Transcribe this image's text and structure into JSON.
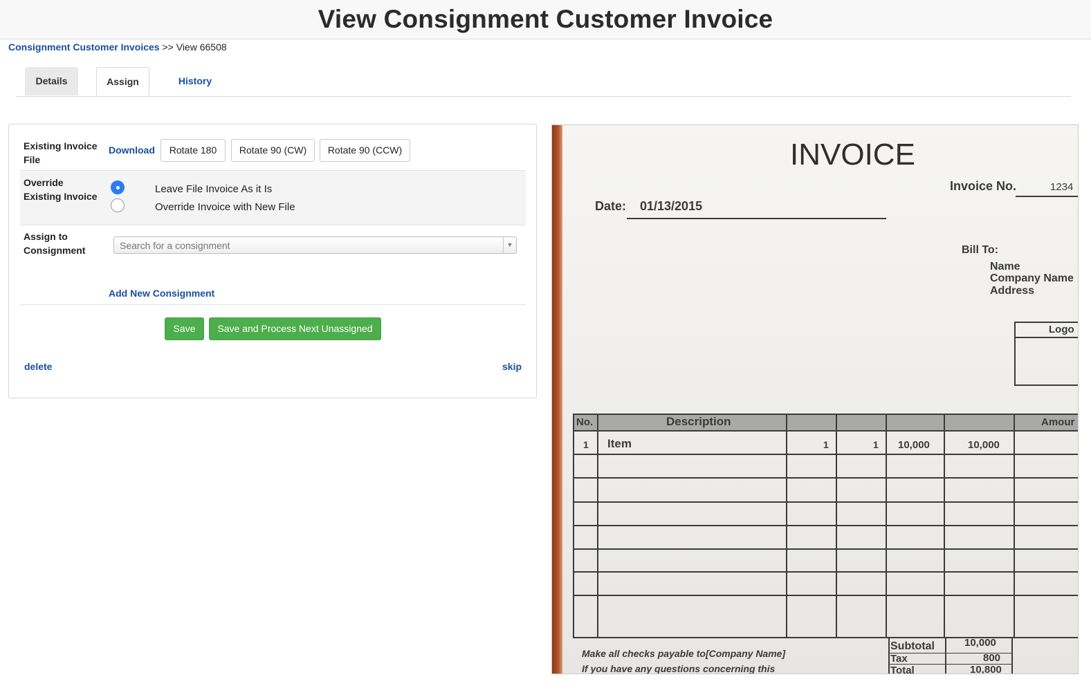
{
  "page": {
    "title": "View Consignment Customer Invoice"
  },
  "breadcrumb": {
    "link": "Consignment Customer Invoices",
    "separator": " >> ",
    "current": "View 66508"
  },
  "tabs": [
    {
      "label": "Details"
    },
    {
      "label": "Assign"
    },
    {
      "label": "History"
    }
  ],
  "existing_file": {
    "label_line1": "Existing Invoice",
    "label_line2": "File",
    "download": "Download",
    "rotate180": "Rotate 180",
    "rotate90cw": "Rotate 90 (CW)",
    "rotate90ccw": "Rotate 90 (CCW)"
  },
  "override": {
    "label_line1": "Override",
    "label_line2": "Existing Invoice",
    "option_leave": "Leave File Invoice As it Is",
    "option_override": "Override Invoice with New File",
    "selected": "leave"
  },
  "assign": {
    "label_line1": "Assign to",
    "label_line2": "Consignment",
    "placeholder": "Search for a consignment",
    "add_new": "Add New Consignment"
  },
  "actions": {
    "save": "Save",
    "save_next": "Save and Process Next Unassigned",
    "delete": "delete",
    "skip": "skip"
  },
  "invoice_image": {
    "heading": "INVOICE",
    "invoice_no_label": "Invoice No.",
    "invoice_no_value": "1234",
    "date_label": "Date:",
    "date_value": "01/13/2015",
    "bill_to": "Bill To:",
    "bill_name": "Name",
    "bill_company": "Company Name",
    "bill_address": "Address",
    "logo": "Logo",
    "col_no": "No.",
    "col_description": "Description",
    "col_amount": "Amour",
    "row1_no": "1",
    "row1_item": "Item",
    "row1_q1": "1",
    "row1_q2": "1",
    "row1_price": "10,000",
    "row1_total": "10,000",
    "subtotal_label": "Subtotal",
    "subtotal_value": "10,000",
    "tax_label": "Tax",
    "tax_value": "800",
    "total_label": "Total",
    "total_value": "10,800",
    "checks_note": "Make all checks payable to[Company Name]",
    "questions_note": "If you have any questions concerning this"
  },
  "colors": {
    "link": "#1a4fa0",
    "green": "#4cae4c",
    "radio": "#2b7cf2"
  }
}
